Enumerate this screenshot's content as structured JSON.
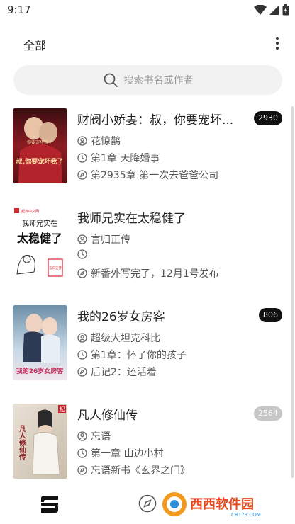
{
  "status": {
    "time": "9:17"
  },
  "header": {
    "title": "全部"
  },
  "search": {
    "placeholder": "搜索书名或作者"
  },
  "books": [
    {
      "title": "财阀小娇妻：叔，你要宠坏...",
      "count": "2930",
      "author": "花惊鹊",
      "latest": "第1章 天降婚事",
      "recent": "第2935章 第一次去爸爸公司"
    },
    {
      "title": "我师兄实在太稳健了",
      "count": "",
      "author": "言归正传",
      "latest": "",
      "recent": "新番外写完了，12月1号发布"
    },
    {
      "title": "我的26岁女房客",
      "count": "806",
      "author": "超级大坦克科比",
      "latest": "第1章：怀了你的孩子",
      "recent": "后记2：还活着"
    },
    {
      "title": "凡人修仙传",
      "count": "2564",
      "author": "忘语",
      "latest": "第一章 山边小村",
      "recent": "忘语新书《玄界之门》"
    }
  ],
  "covers": {
    "book1_tag": "你要宠坏我了",
    "book1_art": "叔,你要宠坏我了",
    "book2_brand": "起点中文网",
    "book2_line1": "我师兄实在",
    "book2_line2": "太稳健了",
    "book2_badge": "言归正传",
    "book3_art": "我的26岁女房客",
    "book4_art": "凡人修仙传",
    "book4_corner": "起"
  },
  "watermark": {
    "text": "西西软件园",
    "site": "CR173.COM"
  },
  "colors": {
    "badge_dark": "#111111",
    "badge_muted": "#c6c6c6",
    "search_bg": "#f2f2f2"
  },
  "icons": [
    "signal-icon",
    "wifi-icon",
    "battery-icon",
    "more-vert-icon",
    "search-icon",
    "author-icon",
    "clock-icon",
    "compass-icon",
    "bookshelf-icon"
  ]
}
